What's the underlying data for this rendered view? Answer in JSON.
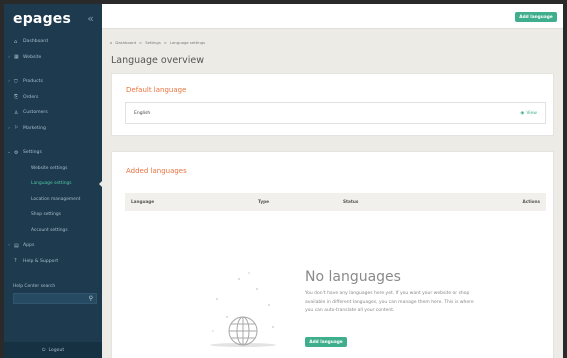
{
  "sidebar": {
    "logo": "epages",
    "collapse_icon": "«",
    "items": [
      {
        "chevron": "",
        "icon": "⌂",
        "label": "Dashboard"
      },
      {
        "chevron": "›",
        "icon": "▦",
        "label": "Website"
      },
      {
        "chevron": "›",
        "icon": "⛉",
        "label": "Products"
      },
      {
        "chevron": "",
        "icon": "⎘",
        "label": "Orders"
      },
      {
        "chevron": "",
        "icon": "♙",
        "label": "Customers"
      },
      {
        "chevron": "›",
        "icon": "⚐",
        "label": "Marketing"
      },
      {
        "chevron": "⌄",
        "icon": "⚙",
        "label": "Settings"
      }
    ],
    "settings_sub": [
      {
        "label": "Website settings"
      },
      {
        "label": "Language settings"
      },
      {
        "label": "Location management"
      },
      {
        "label": "Shop settings"
      },
      {
        "label": "Account settings"
      }
    ],
    "bottom_items": [
      {
        "chevron": "›",
        "icon": "▤",
        "label": "Apps"
      },
      {
        "chevron": "",
        "icon": "?",
        "label": "Help & Support"
      }
    ],
    "help_center_label": "Help Center search",
    "logout_label": "Logout"
  },
  "topbar": {
    "add_language_label": "Add language"
  },
  "breadcrumb": [
    "Dashboard",
    "Settings",
    "Language settings"
  ],
  "breadcrumb_sep": ">",
  "page_title": "Language overview",
  "default_language": {
    "title": "Default language",
    "language": "English",
    "view_label": "View"
  },
  "added_languages": {
    "title": "Added languages",
    "columns": [
      "Language",
      "Type",
      "Status",
      "Actions"
    ],
    "empty_title": "No languages",
    "empty_text": "You don't have any languages here yet. If you want your website or shop available in different languages, you can manage them here. This is where you can auto-translate all your content.",
    "add_language_label": "Add language"
  },
  "colors": {
    "sidebar_bg": "#1d3a4e",
    "accent_green": "#3fae8c",
    "accent_orange": "#e7733e",
    "active_nav": "#4fc7a5"
  }
}
